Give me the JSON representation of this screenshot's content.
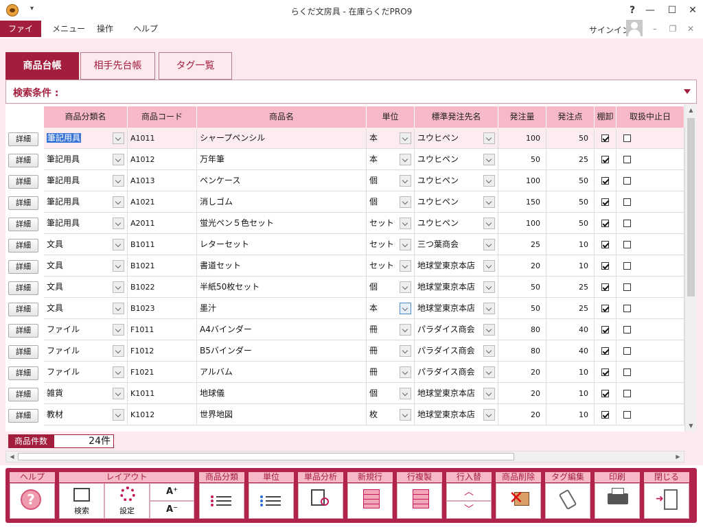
{
  "window": {
    "title": "らくだ文房具 - 在庫らくだPRO9",
    "help": "?",
    "minimize": "—",
    "maximize": "☐",
    "close": "✕"
  },
  "menu": {
    "file": "ファイル",
    "items": [
      "メニュー",
      "操作",
      "ヘルプ"
    ],
    "signin": "サインイン"
  },
  "tabs": [
    "商品台帳",
    "相手先台帳",
    "タグ一覧"
  ],
  "search": {
    "label": "検索条件 :"
  },
  "grid": {
    "detail_label": "詳細",
    "columns": [
      "商品分類名",
      "商品コード",
      "商品名",
      "単位",
      "標準発注先名",
      "発注量",
      "発注点",
      "棚卸",
      "取扱中止日"
    ],
    "rows": [
      {
        "category": "筆記用具",
        "code": "A1011",
        "name": "シャープペンシル",
        "unit": "本",
        "supplier": "ユウヒペン",
        "qty": "100",
        "point": "50",
        "inventory": true
      },
      {
        "category": "筆記用具",
        "code": "A1012",
        "name": "万年筆",
        "unit": "本",
        "supplier": "ユウヒペン",
        "qty": "50",
        "point": "25",
        "inventory": true
      },
      {
        "category": "筆記用具",
        "code": "A1013",
        "name": "ペンケース",
        "unit": "個",
        "supplier": "ユウヒペン",
        "qty": "100",
        "point": "50",
        "inventory": true
      },
      {
        "category": "筆記用具",
        "code": "A1021",
        "name": "消しゴム",
        "unit": "個",
        "supplier": "ユウヒペン",
        "qty": "150",
        "point": "50",
        "inventory": true
      },
      {
        "category": "筆記用具",
        "code": "A2011",
        "name": "蛍光ペン５色セット",
        "unit": "セット",
        "supplier": "ユウヒペン",
        "qty": "100",
        "point": "50",
        "inventory": true
      },
      {
        "category": "文具",
        "code": "B1011",
        "name": "レターセット",
        "unit": "セット",
        "supplier": "三つ葉商会",
        "qty": "25",
        "point": "10",
        "inventory": true
      },
      {
        "category": "文具",
        "code": "B1021",
        "name": "書道セット",
        "unit": "セット",
        "supplier": "地球堂東京本店",
        "qty": "20",
        "point": "10",
        "inventory": true
      },
      {
        "category": "文具",
        "code": "B1022",
        "name": "半紙50枚セット",
        "unit": "個",
        "supplier": "地球堂東京本店",
        "qty": "50",
        "point": "25",
        "inventory": true
      },
      {
        "category": "文具",
        "code": "B1023",
        "name": "墨汁",
        "unit": "本",
        "supplier": "地球堂東京本店",
        "qty": "50",
        "point": "25",
        "inventory": true
      },
      {
        "category": "ファイル",
        "code": "F1011",
        "name": "A4バインダー",
        "unit": "冊",
        "supplier": "パラダイス商会",
        "qty": "80",
        "point": "40",
        "inventory": true
      },
      {
        "category": "ファイル",
        "code": "F1012",
        "name": "B5バインダー",
        "unit": "冊",
        "supplier": "パラダイス商会",
        "qty": "80",
        "point": "40",
        "inventory": true
      },
      {
        "category": "ファイル",
        "code": "F1021",
        "name": "アルバム",
        "unit": "冊",
        "supplier": "パラダイス商会",
        "qty": "20",
        "point": "10",
        "inventory": true
      },
      {
        "category": "雑貨",
        "code": "K1011",
        "name": "地球儀",
        "unit": "個",
        "supplier": "地球堂東京本店",
        "qty": "20",
        "point": "10",
        "inventory": true
      },
      {
        "category": "教材",
        "code": "K1012",
        "name": "世界地図",
        "unit": "枚",
        "supplier": "地球堂東京本店",
        "qty": "20",
        "point": "10",
        "inventory": true
      }
    ]
  },
  "count": {
    "label": "商品件数",
    "value": "24件"
  },
  "toolbar": {
    "help": {
      "group": "ヘルプ"
    },
    "layout": {
      "group": "レイアウト",
      "search": "検索",
      "settings": "設定",
      "font_up": "A⁺",
      "font_down": "A⁻"
    },
    "category": {
      "group": "商品分類"
    },
    "unit": {
      "group": "単位"
    },
    "analysis": {
      "group": "単品分析"
    },
    "new_row": {
      "group": "新規行"
    },
    "copy_row": {
      "group": "行複製"
    },
    "swap_row": {
      "group": "行入替"
    },
    "delete": {
      "group": "商品削除"
    },
    "tag_edit": {
      "group": "タグ編集"
    },
    "print": {
      "group": "印刷"
    },
    "close": {
      "group": "閉じる"
    }
  }
}
